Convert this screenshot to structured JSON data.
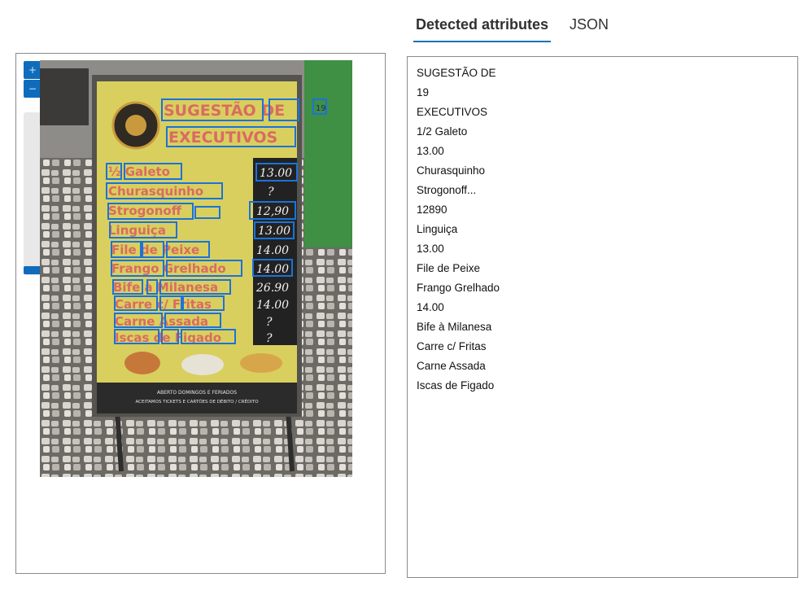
{
  "tabs": {
    "detected": "Detected attributes",
    "json": "JSON"
  },
  "zoom": {
    "in_icon": "+",
    "out_icon": "−"
  },
  "sign": {
    "title1": "SUGESTÃO DE",
    "badge": "19",
    "title2": "EXECUTIVOS",
    "items": [
      {
        "name": "½ Galeto",
        "price": "13.00"
      },
      {
        "name": "Churasquinho",
        "price": "?"
      },
      {
        "name": "Strogonoff",
        "price": "12,90"
      },
      {
        "name": "Linguiça",
        "price": "13.00"
      },
      {
        "name": "File de Peixe",
        "price": "14.00"
      },
      {
        "name": "Frango Grelhado",
        "price": "14.00"
      },
      {
        "name": "Bife à Milanesa",
        "price": "26.90"
      },
      {
        "name": "Carre c/ Fritas",
        "price": "14.00"
      },
      {
        "name": "Carne Assada",
        "price": "?"
      },
      {
        "name": "Iscas de Figado",
        "price": "?"
      }
    ],
    "footer1": "ABERTO DOMINGOS E FERIADOS",
    "footer2": "ACEITAMOS TICKETS E CARTÕES DE DÉBITO / CRÉDITO"
  },
  "attributes": [
    "SUGESTÃO DE",
    "19",
    "EXECUTIVOS",
    "1/2 Galeto",
    "13.00",
    "Churasquinho",
    "Strogonoff...",
    "12890",
    "Linguiça",
    "13.00",
    "File de Peixe",
    "Frango Grelhado",
    "14.00",
    "Bife à Milanesa",
    "Carre c/ Fritas",
    "Carne Assada",
    "Iscas de Figado"
  ],
  "colors": {
    "accent": "#0f6cbd",
    "box": "#1a73d9",
    "sign_yellow": "#d9cf5e",
    "menu_text": "#d96b63"
  }
}
